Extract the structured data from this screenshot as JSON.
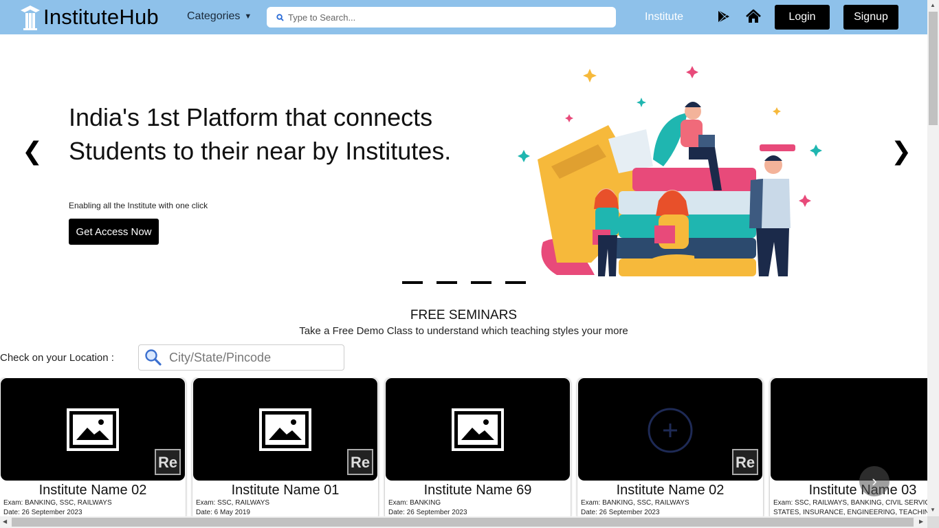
{
  "header": {
    "brand": "InstituteHub",
    "categories_label": "Categories",
    "search_placeholder": "Type to Search...",
    "nav_institute": "Institute",
    "login_label": "Login",
    "signup_label": "Signup",
    "icons": [
      "graduation-pillar-icon",
      "search-icon",
      "caret-down-icon",
      "play-store-icon",
      "home-icon"
    ],
    "bg_color": "#8ec1ea"
  },
  "hero": {
    "title": "India's 1st Platform that connects Students to their near by Institutes.",
    "subtitle": "Enabling all the Institute with one click",
    "cta_label": "Get Access Now",
    "prev_arrow": "❮",
    "next_arrow": "❯",
    "slide_count": 4
  },
  "seminars": {
    "title": "FREE SEMINARS",
    "subtitle": "Take a Free Demo Class to understand which teaching styles your more",
    "location_label": "Check on your Location :",
    "location_placeholder": "City/State/Pincode",
    "cards": [
      {
        "name": "Institute Name 02",
        "exam": "Exam: BANKING, SSC, RAILWAYS",
        "date": "Date: 26 September 2023",
        "image": "image-placeholder"
      },
      {
        "name": "Institute Name 01",
        "exam": "Exam: SSC, RAILWAYS",
        "date": "Date: 6 May 2019",
        "image": "image-placeholder"
      },
      {
        "name": "Institute Name 69",
        "exam": "Exam: BANKING",
        "date": "Date: 26 September 2023",
        "image": "image-placeholder"
      },
      {
        "name": "Institute Name 02",
        "exam": "Exam: BANKING, SSC, RAILWAYS",
        "date": "Date: 26 September 2023",
        "image": "plus-circle"
      },
      {
        "name": "Institute Name 03",
        "exam": "Exam: SSC, RAILWAYS, BANKING, CIVIL SERVICES,",
        "date": "STATES, INSURANCE, ENGINEERING, TEACHING",
        "image": "blank"
      }
    ],
    "next_label": "›"
  }
}
